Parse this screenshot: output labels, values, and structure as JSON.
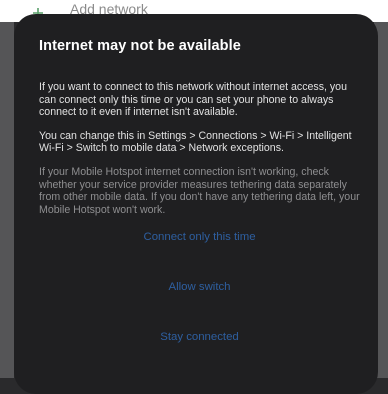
{
  "background_screen": {
    "cut_item_label": "Add network"
  },
  "dialog": {
    "title": "Internet may not be available",
    "paragraph_1": "If you want to connect to this network without internet access, you can connect only this time or you can set your phone to always connect to it even if internet isn't available.",
    "paragraph_2": "You can change this in Settings > Connections > Wi-Fi > Intelligent Wi-Fi > Switch to mobile data > Network exceptions.",
    "paragraph_3": "If your Mobile Hotspot internet connection isn't working, check whether your service provider measures tethering data separately from other mobile data. If you don't have any tethering data left, your Mobile Hotspot won't work.",
    "actions": {
      "connect_once": "Connect only this time",
      "allow_switch": "Allow switch",
      "stay_connected": "Stay connected"
    }
  },
  "colors": {
    "dialog_background": "#1f1f21",
    "action_text": "#2e5fa0",
    "muted_text": "#8e8e90"
  }
}
